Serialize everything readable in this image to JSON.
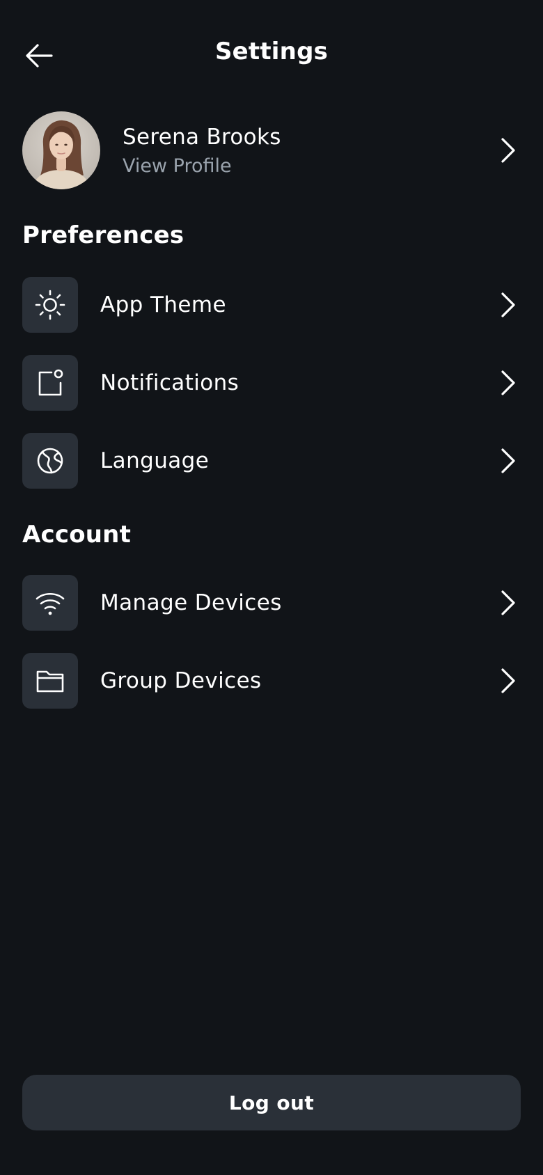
{
  "header": {
    "title": "Settings",
    "back_icon": "arrow-left-icon"
  },
  "profile": {
    "name": "Serena Brooks",
    "subtitle": "View Profile"
  },
  "sections": {
    "preferences": {
      "title": "Preferences",
      "items": [
        {
          "label": "App Theme",
          "icon": "sun-icon"
        },
        {
          "label": "Notifications",
          "icon": "notification-icon"
        },
        {
          "label": "Language",
          "icon": "globe-icon"
        }
      ]
    },
    "account": {
      "title": "Account",
      "items": [
        {
          "label": "Manage Devices",
          "icon": "wifi-icon"
        },
        {
          "label": "Group Devices",
          "icon": "folder-icon"
        }
      ]
    }
  },
  "logout_label": "Log out",
  "colors": {
    "background": "#111418",
    "surface": "#2a3038",
    "text": "#ffffff",
    "muted": "#9aa3ad"
  }
}
